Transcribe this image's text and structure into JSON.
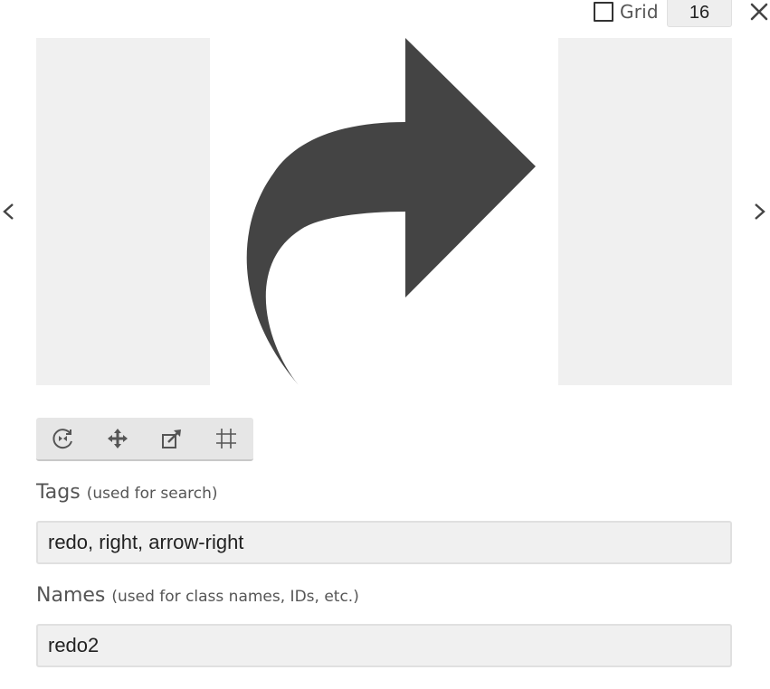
{
  "topbar": {
    "grid_label": "Grid",
    "grid_checked": false,
    "grid_size": "16",
    "icons": {
      "close": "close-icon"
    }
  },
  "preview": {
    "glyph_icon": "redo-arrow-glyph",
    "glyph_color": "#444444",
    "padding_color": "#f0f0f0",
    "nav_prev_icon": "chevron-left-icon",
    "nav_next_icon": "chevron-right-icon"
  },
  "toolbar": {
    "tools": [
      "rotate-flip-icon",
      "move-icon",
      "resize-icon",
      "grid-crop-icon"
    ]
  },
  "tags": {
    "label": "Tags",
    "hint": "(used for search)",
    "value": "redo, right, arrow-right"
  },
  "names": {
    "label": "Names",
    "hint": "(used for class names, IDs, etc.)",
    "value": "redo2"
  },
  "colors": {
    "icon": "#444444",
    "field_bg": "#f0f0f0",
    "toolbar_bg": "#e6e6e6",
    "text": "#555555"
  }
}
